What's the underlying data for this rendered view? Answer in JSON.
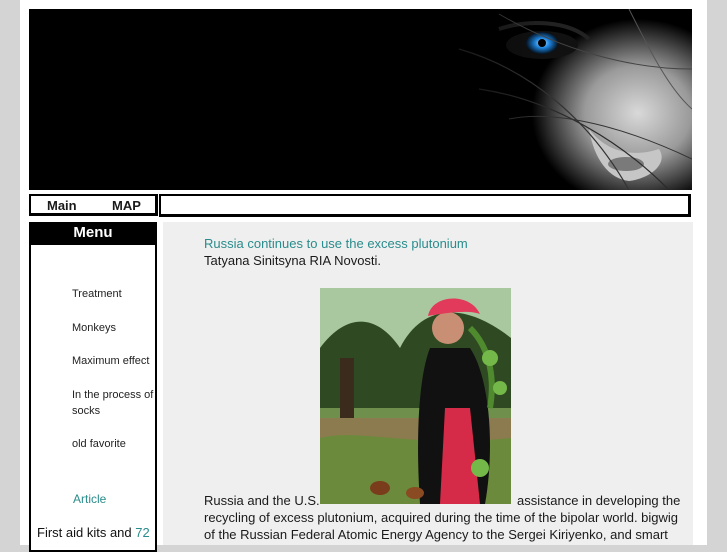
{
  "nav": {
    "main_label": "Main",
    "map_label": "MAP"
  },
  "sidebar": {
    "menu_title": "Menu",
    "items": [
      {
        "label": "Treatment"
      },
      {
        "label": "Monkeys"
      },
      {
        "label": "Maximum effect"
      },
      {
        "label": "In the process of socks"
      },
      {
        "label": "old favorite"
      }
    ],
    "article_label": "Article",
    "kits_label": "First aid kits and",
    "kits_count": "72"
  },
  "article": {
    "headline": "Russia continues to use the excess plutonium",
    "byline": "Tatyana Sinitsyna RIA Novosti.",
    "line1_start": "Russia and the U.S.",
    "line1_end": "assistance in developing the",
    "line2": "recycling of excess plutonium, acquired during the time of the bipolar world. bigwig",
    "line3": "of the Russian Federal Atomic Energy Agency to the Sergei Kiriyenko, and smart"
  }
}
